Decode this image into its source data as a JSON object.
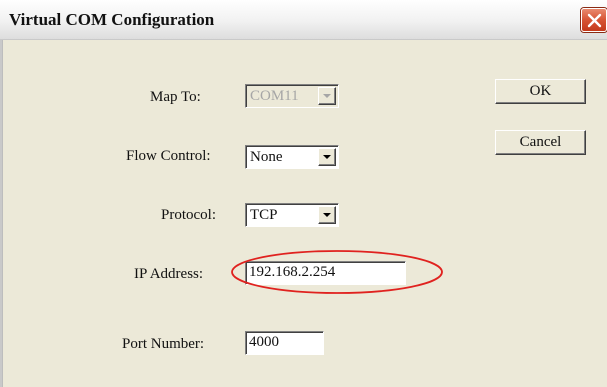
{
  "window": {
    "title": "Virtual COM Configuration"
  },
  "fields": {
    "map_to": {
      "label": "Map To:",
      "value": "COM11",
      "disabled": true
    },
    "flow_control": {
      "label": "Flow Control:",
      "value": "None"
    },
    "protocol": {
      "label": "Protocol:",
      "value": "TCP"
    },
    "ip_address": {
      "label": "IP Address:",
      "value": "192.168.2.254"
    },
    "port_number": {
      "label": "Port Number:",
      "value": "4000"
    }
  },
  "buttons": {
    "ok_label": "OK",
    "cancel_label": "Cancel"
  },
  "icons": {
    "close": "close-icon",
    "dropdown": "chevron-down-icon"
  },
  "colors": {
    "dialog_background": "#ece9d8",
    "close_button": "#d75434",
    "highlight_ellipse": "#e0221f"
  }
}
